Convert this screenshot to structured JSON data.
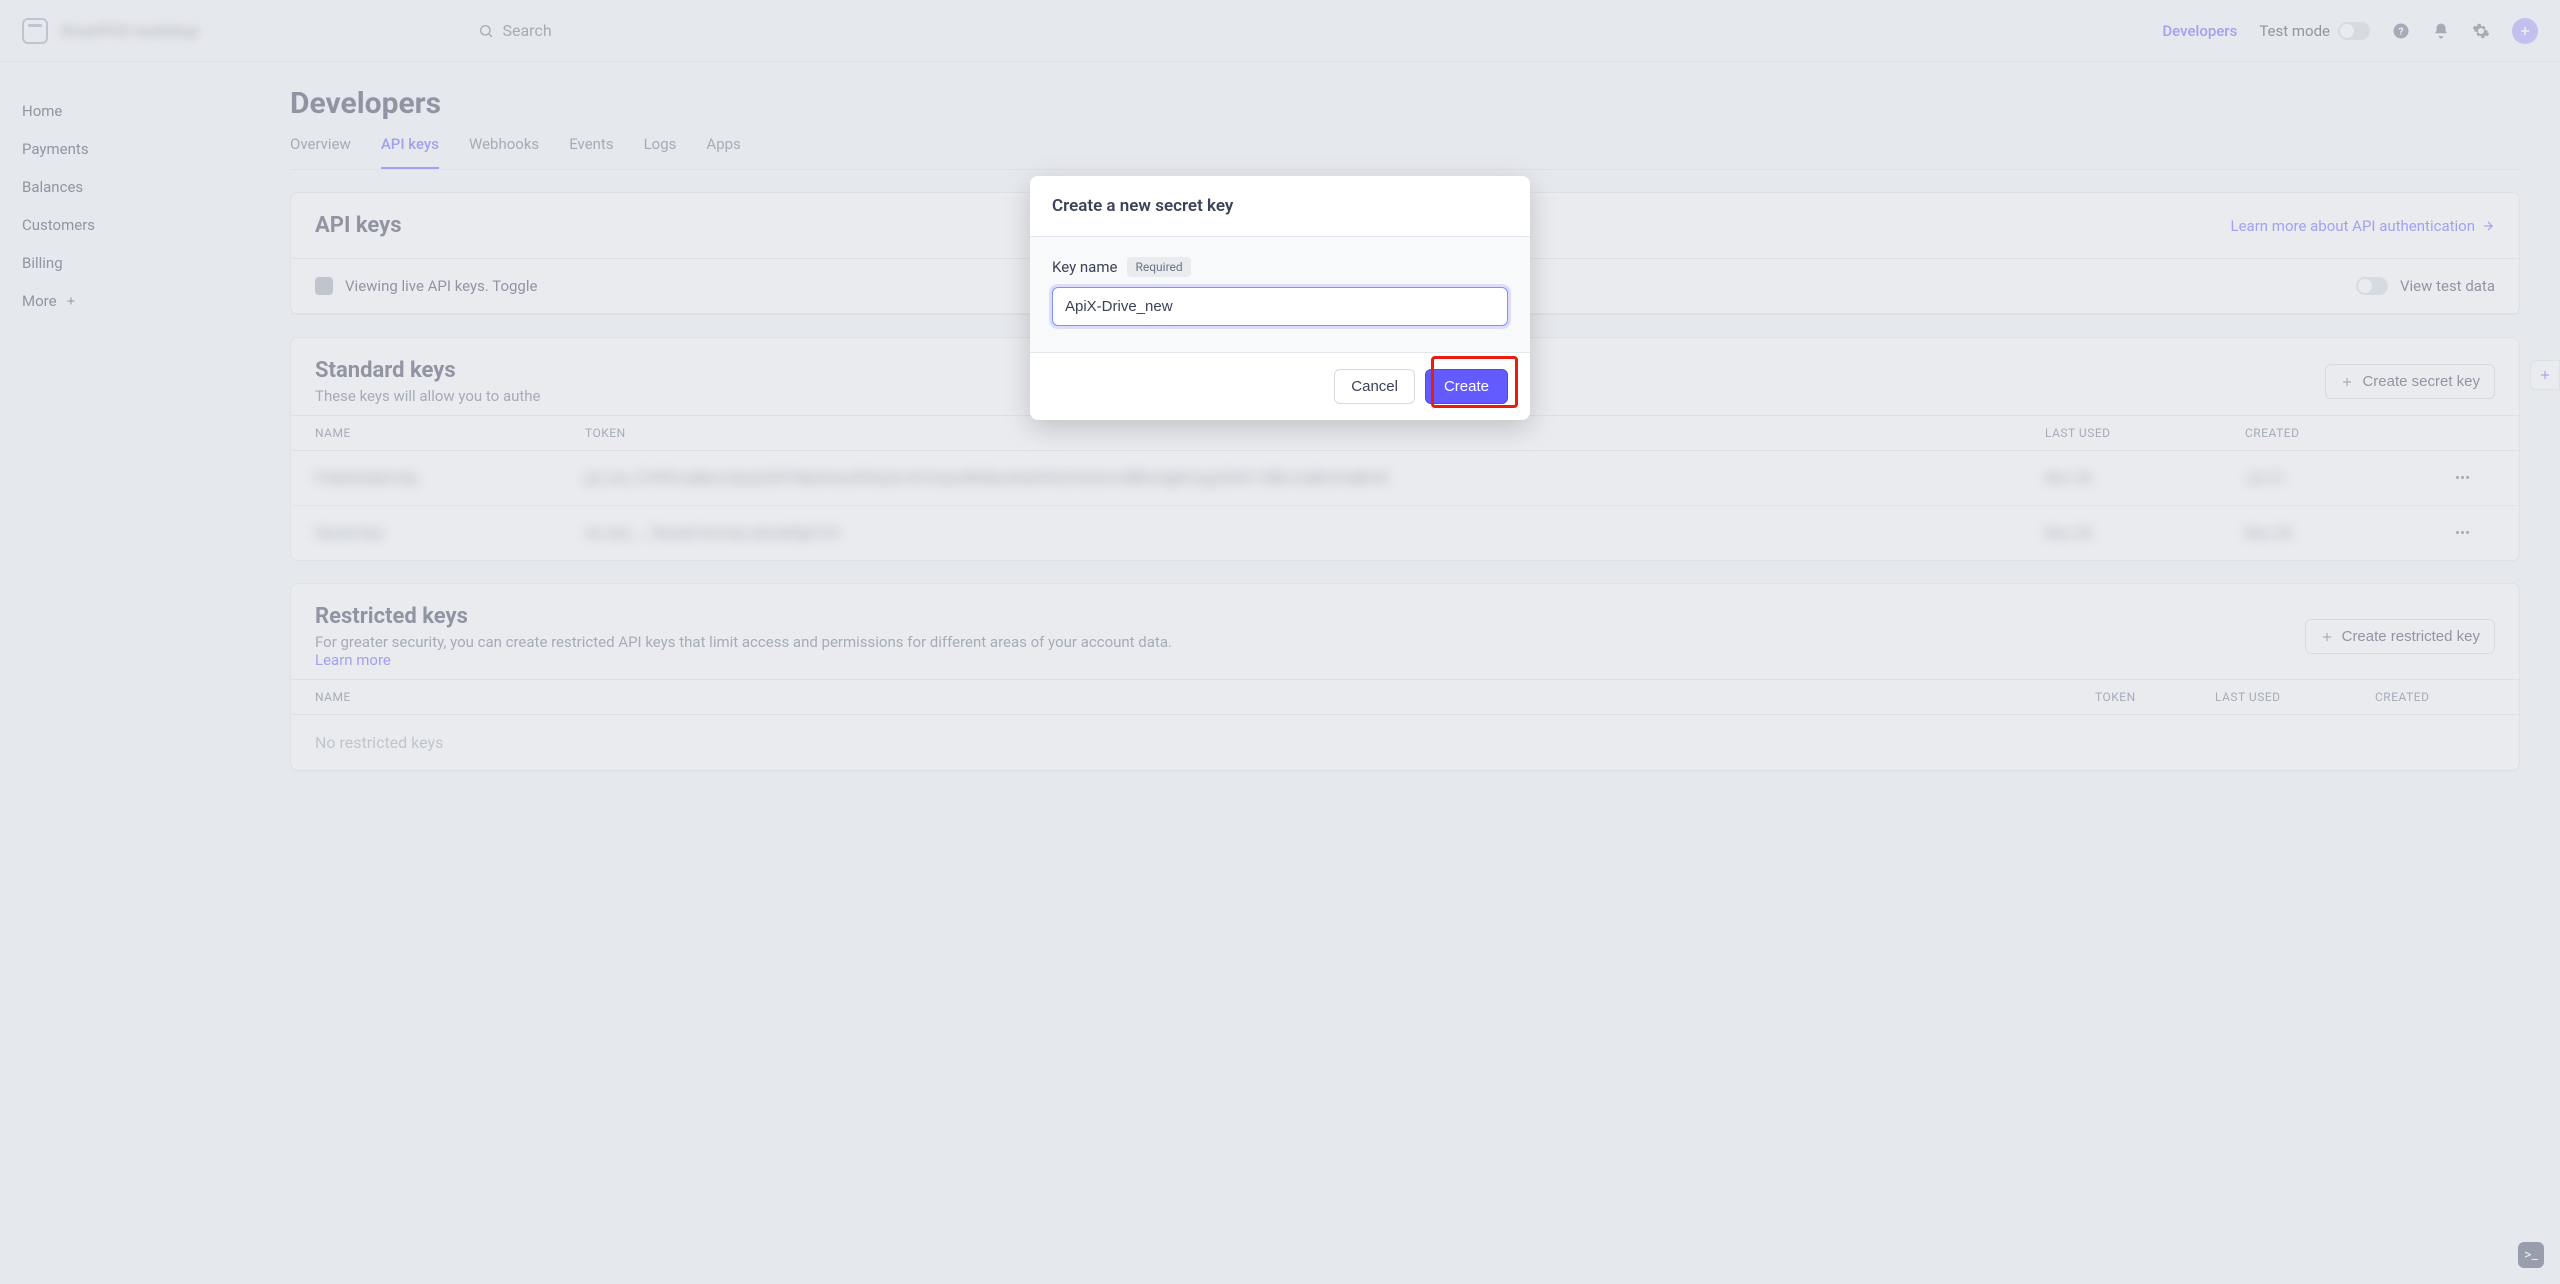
{
  "brand_name": "SmartPOS workshop",
  "search_placeholder": "Search",
  "top": {
    "developers": "Developers",
    "test_mode": "Test mode"
  },
  "sidebar": {
    "items": [
      {
        "label": "Home"
      },
      {
        "label": "Payments"
      },
      {
        "label": "Balances"
      },
      {
        "label": "Customers"
      },
      {
        "label": "Billing"
      },
      {
        "label": "More"
      }
    ]
  },
  "page": {
    "title": "Developers",
    "tabs": [
      "Overview",
      "API keys",
      "Webhooks",
      "Events",
      "Logs",
      "Apps"
    ],
    "active_tab": 1
  },
  "section_api": {
    "heading": "API keys",
    "learn_more": "Learn more about API authentication",
    "banner": "Viewing live API keys. Toggle",
    "view_test": "View test data"
  },
  "std_keys": {
    "heading": "Standard keys",
    "subtitle": "These keys will allow you to authe",
    "create_btn": "Create secret key",
    "columns": {
      "name": "NAME",
      "token": "TOKEN",
      "last": "LAST USED",
      "created": "CREATED"
    },
    "rows": [
      {
        "name": "Publishable key",
        "token": "pk_live_51NfCxaBencdynp3iW7Mp4rewzfhhtyta 0rCmpuWM9pwNz8HQchwZernrBBhoQjjhCaypGhKV SBKJnaBtzIVqBmR",
        "last": "Nov 26",
        "created": "Jul 31"
      },
      {
        "name": "Secret key",
        "token": "sk_live_...  Reveal live key  abcdefg0123",
        "last": "Nov 26",
        "created": "Nov 26"
      }
    ]
  },
  "restricted": {
    "heading": "Restricted keys",
    "desc": "For greater security, you can create restricted API keys that limit access and permissions for different areas of your account data. ",
    "learn": "Learn more",
    "create_btn": "Create restricted key",
    "columns": {
      "name": "NAME",
      "token": "TOKEN",
      "last": "LAST USED",
      "created": "CREATED"
    },
    "empty": "No restricted keys"
  },
  "modal": {
    "title": "Create a new secret key",
    "field_label": "Key name",
    "required": "Required",
    "value": "ApiX-Drive_new",
    "cancel": "Cancel",
    "create": "Create"
  }
}
